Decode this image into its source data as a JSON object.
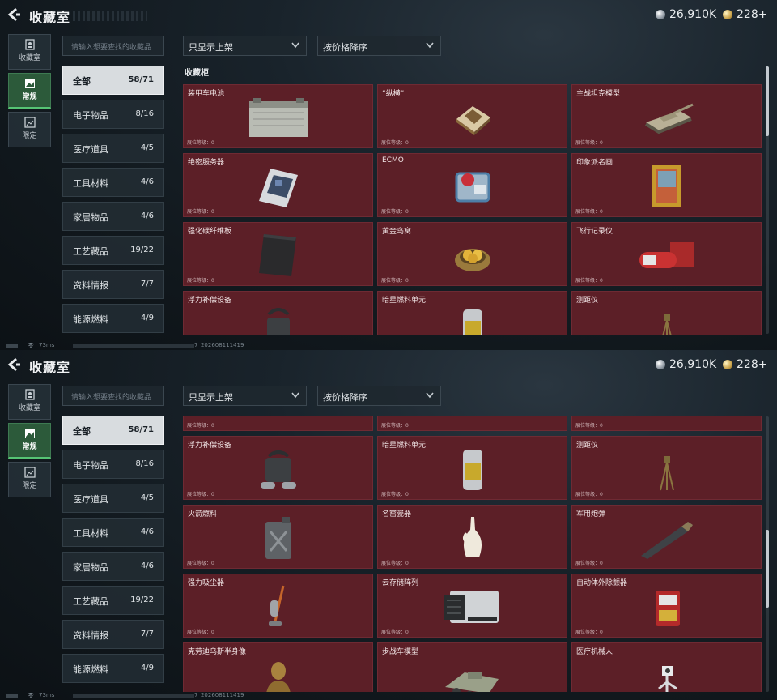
{
  "header": {
    "title": "收藏室"
  },
  "currency": {
    "coins": "26,910K",
    "tickets": "228+"
  },
  "side_tabs": [
    {
      "label": "收藏室",
      "icon": "portrait-icon"
    },
    {
      "label": "常规",
      "icon": "picture-icon"
    },
    {
      "label": "限定",
      "icon": "landscape-icon"
    }
  ],
  "search": {
    "placeholder": "请输入想要查找的收藏品"
  },
  "filters": {
    "shelf_filter": "只显示上架",
    "sort": "按价格降序"
  },
  "categories": [
    {
      "label": "全部",
      "count": "58/71"
    },
    {
      "label": "电子物品",
      "count": "8/16"
    },
    {
      "label": "医疗道具",
      "count": "4/5"
    },
    {
      "label": "工具材料",
      "count": "4/6"
    },
    {
      "label": "家居物品",
      "count": "4/6"
    },
    {
      "label": "工艺藏品",
      "count": "19/22"
    },
    {
      "label": "资料情报",
      "count": "7/7"
    },
    {
      "label": "能源燃料",
      "count": "4/9"
    }
  ],
  "section_label": "收藏柜",
  "level_label": "展位等级：0",
  "items": [
    {
      "name": "装甲车电池",
      "icon": "battery-icon"
    },
    {
      "name": "“纵横”",
      "icon": "chessboard-icon"
    },
    {
      "name": "主战坦克模型",
      "icon": "tank-model-icon"
    },
    {
      "name": "绝密服务器",
      "icon": "server-icon"
    },
    {
      "name": "ECMO",
      "icon": "ecmo-machine-icon"
    },
    {
      "name": "印象派名画",
      "icon": "painting-icon"
    },
    {
      "name": "强化碳纤维板",
      "icon": "carbon-plate-icon"
    },
    {
      "name": "黄金鸟窝",
      "icon": "golden-nest-icon"
    },
    {
      "name": "飞行记录仪",
      "icon": "flight-recorder-icon"
    },
    {
      "name": "浮力补偿设备",
      "icon": "buoyancy-device-icon"
    },
    {
      "name": "暗星燃料单元",
      "icon": "fuel-cell-icon"
    },
    {
      "name": "测距仪",
      "icon": "rangefinder-icon"
    },
    {
      "name": "火箭燃料",
      "icon": "fuel-can-icon"
    },
    {
      "name": "名窑瓷器",
      "icon": "porcelain-vase-icon"
    },
    {
      "name": "军用炮弹",
      "icon": "artillery-shell-icon"
    },
    {
      "name": "强力吸尘器",
      "icon": "vacuum-icon"
    },
    {
      "name": "云存储阵列",
      "icon": "storage-array-icon"
    },
    {
      "name": "自动体外除颤器",
      "icon": "defibrillator-icon"
    },
    {
      "name": "克劳迪乌斯半身像",
      "icon": "bust-icon"
    },
    {
      "name": "步战车模型",
      "icon": "ifv-model-icon"
    },
    {
      "name": "医疗机械人",
      "icon": "medical-robot-icon"
    }
  ],
  "status": {
    "ping": "73ms",
    "build": "7_202608111419"
  }
}
